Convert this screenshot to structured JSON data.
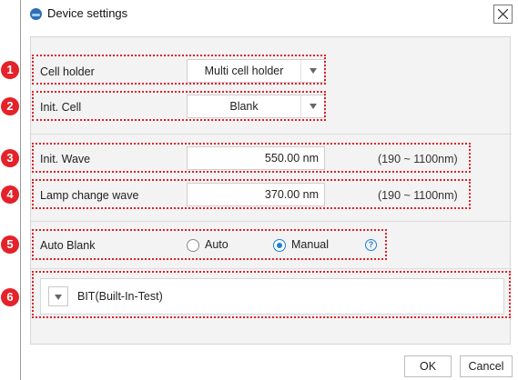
{
  "window": {
    "title": "Device settings",
    "app_icon": "app-logo-icon",
    "close_icon": "close-icon"
  },
  "cell_holder": {
    "label": "Cell holder",
    "value": "Multi cell holder"
  },
  "init_cell": {
    "label": "Init. Cell",
    "value": "Blank"
  },
  "init_wave": {
    "label": "Init. Wave",
    "value": "550.00 nm",
    "range": "(190 ~ 1100nm)"
  },
  "lamp_change_wave": {
    "label": "Lamp change wave",
    "value": "370.00 nm",
    "range": "(190 ~ 1100nm)"
  },
  "auto_blank": {
    "label": "Auto Blank",
    "options": [
      "Auto",
      "Manual"
    ],
    "selected": "Manual",
    "help_glyph": "?"
  },
  "bit": {
    "label": "BIT(Built-In-Test)"
  },
  "annotations": [
    "1",
    "2",
    "3",
    "4",
    "5",
    "6"
  ],
  "buttons": {
    "ok": "OK",
    "cancel": "Cancel"
  },
  "colors": {
    "annotation_red": "#e42229",
    "accent_blue": "#1e7fd8"
  }
}
